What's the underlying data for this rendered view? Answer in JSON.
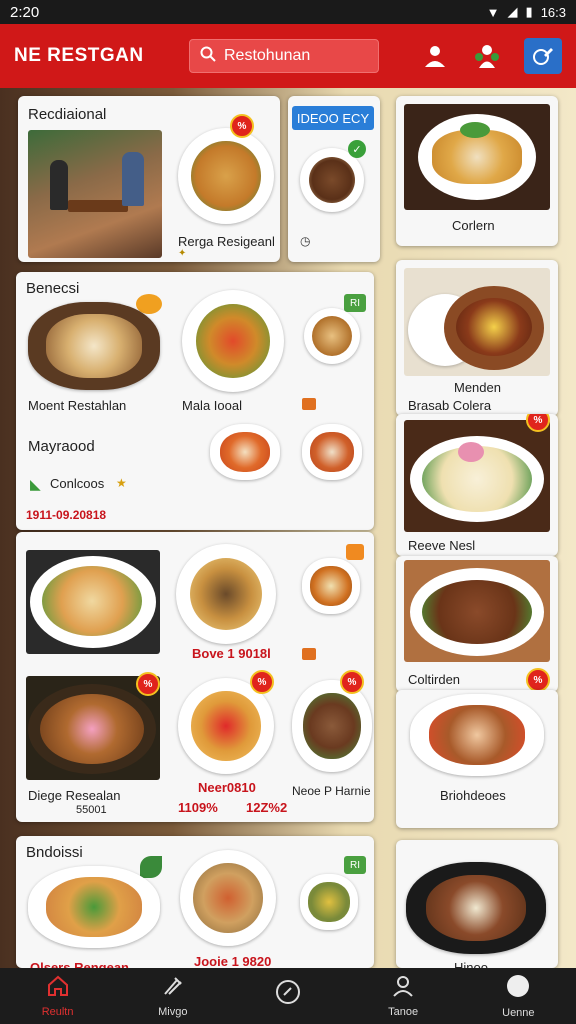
{
  "status_bar": {
    "time": "2:20",
    "clock": "16:3",
    "icons": [
      "wifi-icon",
      "signal-icon",
      "battery-icon"
    ]
  },
  "app_bar": {
    "title": "NE  RESTGAN",
    "search_text": "Restohunan"
  },
  "cards": {
    "c1": {
      "title": "Recdiaional",
      "caption": "Rerga Resigeanl"
    },
    "c2": {
      "button": "IDEOO ECY"
    },
    "c3": {
      "caption": "Corlern"
    },
    "c4": {
      "title": "Benecsi",
      "item1": "Moent Restahlan",
      "item2": "Mala Iooal",
      "subtitle": "Mayraood",
      "chip": "Conlcoos",
      "red_text": "1911-09.20818"
    },
    "c5": {
      "caption": "Menden",
      "sub": "Brasab Colera"
    },
    "c6": {
      "caption": "Reeve Nesl"
    },
    "c7": {
      "price_center": "Bove 1 9018l",
      "item_left": "Diege Resealan",
      "item_left_sub": "55001",
      "item_center": "Neer0810",
      "item_right": "Neoe P Harnie",
      "price_left": "1109%",
      "price_center2": "12Z%2"
    },
    "c8": {
      "caption": "Coltirden"
    },
    "c9": {
      "caption": "Briohdeoes"
    },
    "c10": {
      "title": "Bndoissi",
      "item_left": "Olsers Rengean",
      "item_center": "Jooie 1 9820"
    },
    "c11": {
      "caption": "Hinoo"
    }
  },
  "bottom_nav": [
    {
      "label": "Reultn",
      "icon": "home-icon",
      "active": true
    },
    {
      "label": "Mivgo",
      "icon": "utensils-icon",
      "active": false
    },
    {
      "label": "",
      "icon": "compass-icon",
      "active": false
    },
    {
      "label": "Tanoe",
      "icon": "user-icon",
      "active": false
    },
    {
      "label": "Uenne",
      "icon": "profile-circle-icon",
      "active": false
    }
  ],
  "colors": {
    "brand": "#d01818",
    "accent_blue": "#2a7ed8",
    "nav_bg": "#1c1c1c"
  }
}
